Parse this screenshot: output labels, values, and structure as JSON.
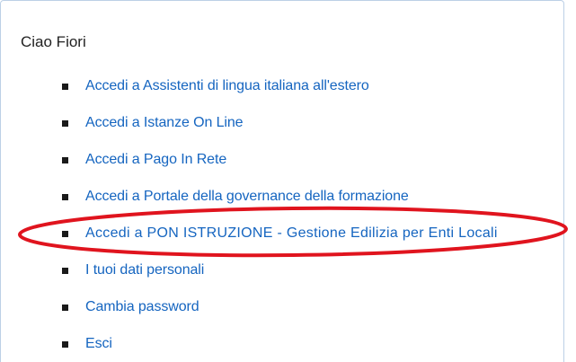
{
  "greeting": "Ciao Fiori",
  "menu": {
    "items": [
      {
        "label": "Accedi a Assistenti di lingua italiana all'estero"
      },
      {
        "label": "Accedi a Istanze On Line"
      },
      {
        "label": "Accedi a Pago In Rete"
      },
      {
        "label": "Accedi a Portale della governance della formazione"
      },
      {
        "label": "Accedi a PON ISTRUZIONE - Gestione Edilizia per Enti Locali"
      },
      {
        "label": "I tuoi dati personali"
      },
      {
        "label": "Cambia password"
      },
      {
        "label": "Esci"
      }
    ]
  },
  "colors": {
    "link": "#1565c0",
    "highlight_ellipse": "#e0141e",
    "panel_border": "#bcd0e6"
  }
}
